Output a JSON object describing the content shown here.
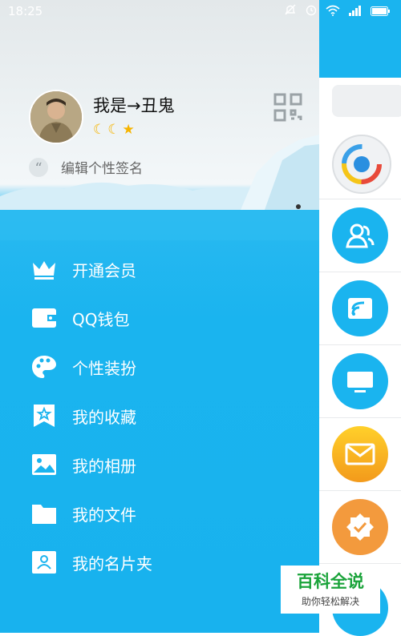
{
  "status_bar": {
    "time": "18:25"
  },
  "profile": {
    "nickname": "我是→丑鬼",
    "badges": [
      "☾",
      "☾",
      "★"
    ],
    "signature_placeholder": "编辑个性签名"
  },
  "menu": [
    {
      "label": "开通会员",
      "icon": "crown-icon"
    },
    {
      "label": "QQ钱包",
      "icon": "wallet-icon"
    },
    {
      "label": "个性装扮",
      "icon": "palette-icon"
    },
    {
      "label": "我的收藏",
      "icon": "favorites-icon"
    },
    {
      "label": "我的相册",
      "icon": "photo-album-icon"
    },
    {
      "label": "我的文件",
      "icon": "folder-icon"
    },
    {
      "label": "我的名片夹",
      "icon": "business-card-icon"
    }
  ],
  "right_panel_icons": [
    "qq-group-app-icon",
    "contacts-icon",
    "subscription-icon",
    "desktop-icon",
    "mail-icon",
    "certified-icon"
  ],
  "watermark": {
    "title": "百科全说",
    "subtitle": "助你轻松解决"
  },
  "colors": {
    "drawer_blue": "#1ab4ef",
    "watermark_green": "#1aa33a",
    "mail_orange": "#f7a21b",
    "certified_orange": "#f39a3d"
  }
}
